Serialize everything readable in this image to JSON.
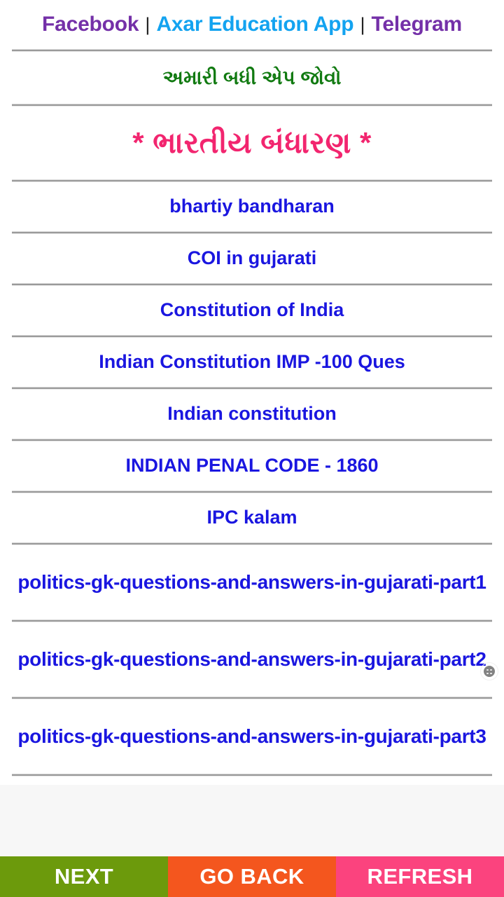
{
  "header": {
    "links": [
      {
        "label": "Facebook",
        "color": "#7430a8",
        "name": "facebook-link"
      },
      {
        "label": "Axar Education App",
        "color": "#13a3f0",
        "name": "axar-education-app-link"
      },
      {
        "label": "Telegram",
        "color": "#7430a8",
        "name": "telegram-link"
      }
    ],
    "separator": "|"
  },
  "banner_green": {
    "text": "અમારી બધી એપ જોવો",
    "color": "#117a11"
  },
  "page_title": {
    "text": "* ભારતીય બંધારણ *",
    "color": "#f2256f"
  },
  "list": {
    "link_color": "#1a16e0",
    "items": [
      {
        "label": "bhartiy bandharan",
        "multiline": false
      },
      {
        "label": "COI in gujarati",
        "multiline": false
      },
      {
        "label": "Constitution of India",
        "multiline": false
      },
      {
        "label": "Indian Constitution IMP -100 Ques",
        "multiline": false
      },
      {
        "label": "Indian constitution",
        "multiline": false
      },
      {
        "label": "INDIAN PENAL CODE - 1860",
        "multiline": false
      },
      {
        "label": "IPC kalam",
        "multiline": false
      },
      {
        "label": "politics-gk-questions-and-answers-in-gujarati-part1",
        "multiline": true
      },
      {
        "label": "politics-gk-questions-and-answers-in-gujarati-part2",
        "multiline": true
      },
      {
        "label": "politics-gk-questions-and-answers-in-gujarati-part3",
        "multiline": true
      }
    ]
  },
  "marker": {
    "icon": "dotted-circle-icon"
  },
  "footer": {
    "buttons": [
      {
        "label": "NEXT",
        "color": "#6c9a0c",
        "name": "next-button"
      },
      {
        "label": "GO BACK",
        "color": "#f4561e",
        "name": "go-back-button"
      },
      {
        "label": "REFRESH",
        "color": "#fb437e",
        "name": "refresh-button"
      }
    ]
  }
}
